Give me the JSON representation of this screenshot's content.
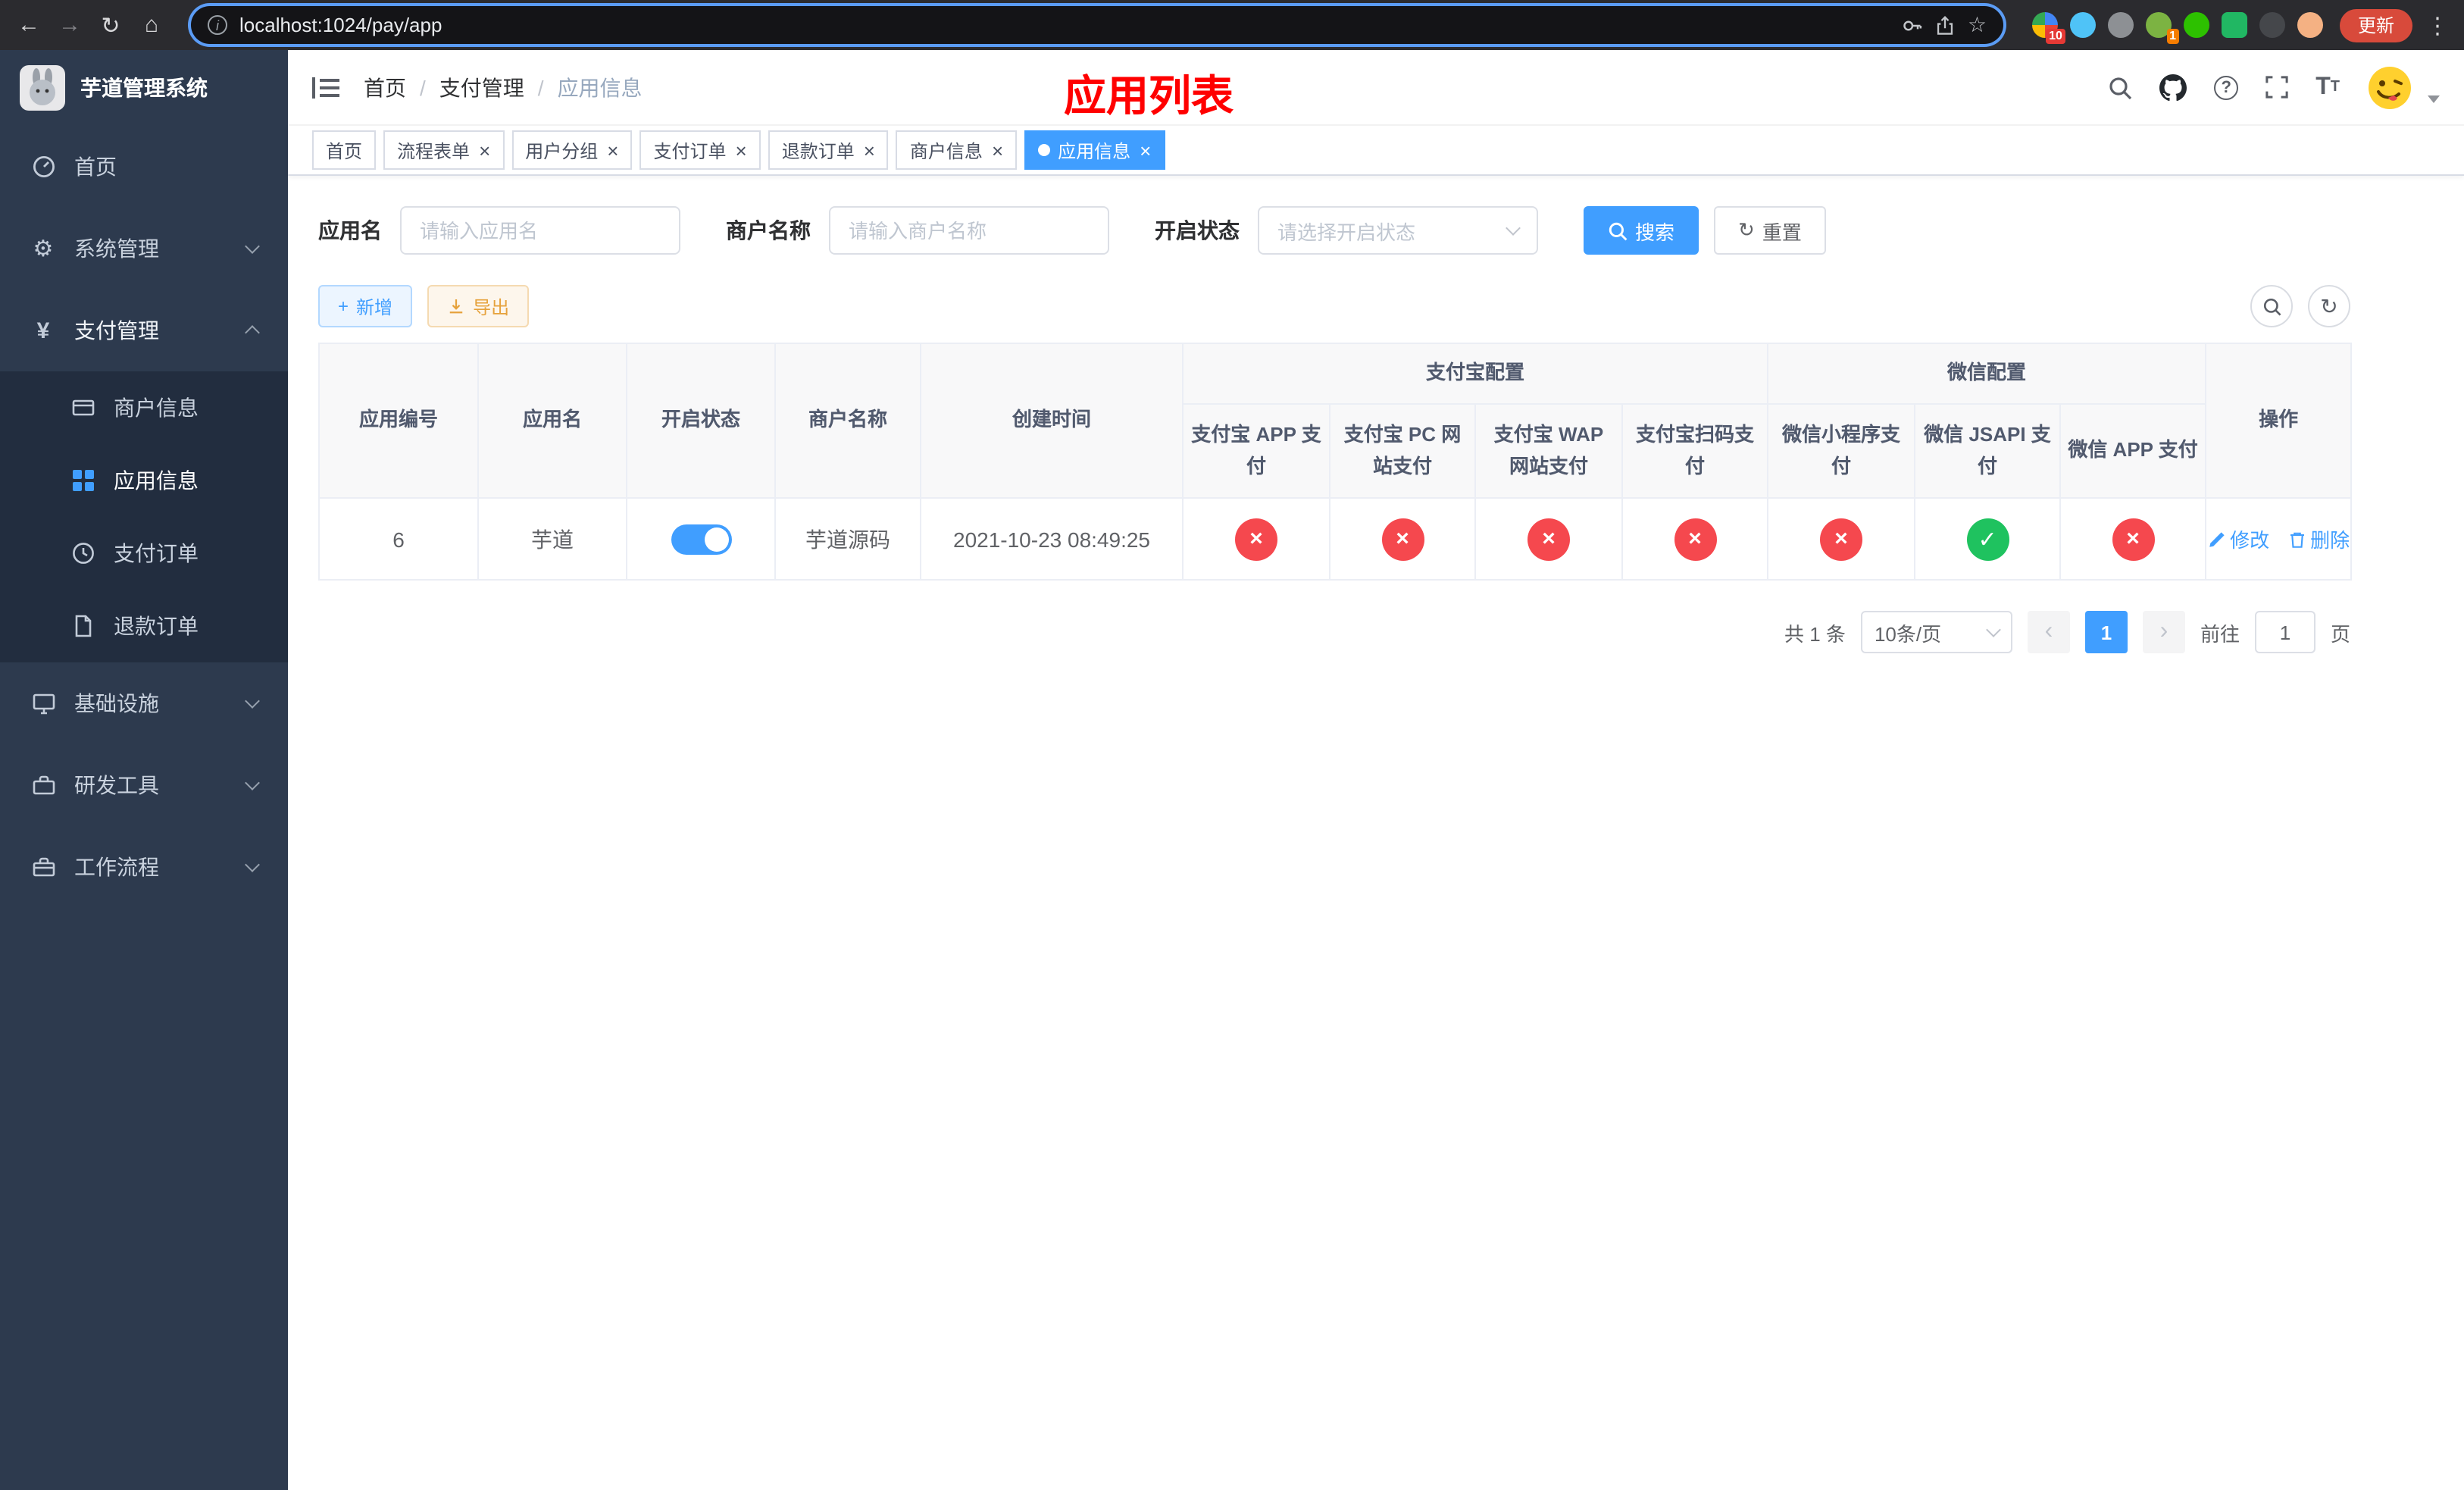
{
  "colors": {
    "primary": "#409eff",
    "success": "#1fc25f",
    "danger": "#f5484e",
    "warning": "#e6a23c",
    "title-red": "#ff0000",
    "sidebar-bg": "#2d3a4e",
    "submenu-bg": "#222d3f",
    "update-red": "#d84a3b"
  },
  "icons": {
    "back": "←",
    "forward": "→",
    "reload": "↻",
    "home": "⌂",
    "bookmark": "☆",
    "menu_kebab": "⋮",
    "info": "i",
    "gear": "⚙",
    "yen": "¥",
    "help": "?",
    "plus": "+",
    "prev": "‹",
    "next": "›",
    "close": "×",
    "refresh": "↻"
  },
  "browser": {
    "url": "localhost:1024/pay/app",
    "update_button": "更新",
    "ext_badge_count": "10",
    "ext_badge_count_2": "1"
  },
  "sidebar": {
    "title": "芋道管理系统",
    "home": "首页",
    "system": "系统管理",
    "payment": "支付管理",
    "merchant": "商户信息",
    "app_info": "应用信息",
    "pay_order": "支付订单",
    "refund_order": "退款订单",
    "infra": "基础设施",
    "dev_tools": "研发工具",
    "workflow": "工作流程"
  },
  "header": {
    "breadcrumb": [
      "首页",
      "支付管理",
      "应用信息"
    ],
    "page_title": "应用列表"
  },
  "tabs": [
    {
      "label": "首页",
      "closable": false,
      "active": false
    },
    {
      "label": "流程表单",
      "closable": true,
      "active": false
    },
    {
      "label": "用户分组",
      "closable": true,
      "active": false
    },
    {
      "label": "支付订单",
      "closable": true,
      "active": false
    },
    {
      "label": "退款订单",
      "closable": true,
      "active": false
    },
    {
      "label": "商户信息",
      "closable": true,
      "active": false
    },
    {
      "label": "应用信息",
      "closable": true,
      "active": true
    }
  ],
  "filters": {
    "app_name_label": "应用名",
    "app_name_placeholder": "请输入应用名",
    "merchant_label": "商户名称",
    "merchant_placeholder": "请输入商户名称",
    "status_label": "开启状态",
    "status_placeholder": "请选择开启状态",
    "search_button": "搜索",
    "reset_button": "重置"
  },
  "toolbar": {
    "add_button": "新增",
    "export_button": "导出"
  },
  "table": {
    "group_alipay": "支付宝配置",
    "group_wechat": "微信配置",
    "headers": {
      "app_id": "应用编号",
      "app_name": "应用名",
      "status": "开启状态",
      "merchant": "商户名称",
      "created": "创建时间",
      "alipay_app": "支付宝 APP 支付",
      "alipay_pc": "支付宝 PC 网站支付",
      "alipay_wap": "支付宝 WAP 网站支付",
      "alipay_qr": "支付宝扫码支付",
      "wechat_mini": "微信小程序支付",
      "wechat_jsapi": "微信 JSAPI 支付",
      "wechat_app": "微信 APP 支付",
      "actions": "操作"
    },
    "rows": [
      {
        "app_id": "6",
        "app_name": "芋道",
        "status_on": true,
        "merchant": "芋道源码",
        "created": "2021-10-23 08:49:25",
        "configs": [
          false,
          false,
          false,
          false,
          false,
          true,
          false
        ],
        "edit_label": "修改",
        "delete_label": "删除"
      }
    ]
  },
  "pagination": {
    "total": "共 1 条",
    "page_size": "10条/页",
    "page": "1",
    "goto_label": "前往",
    "goto_value": "1",
    "unit_label": "页"
  }
}
